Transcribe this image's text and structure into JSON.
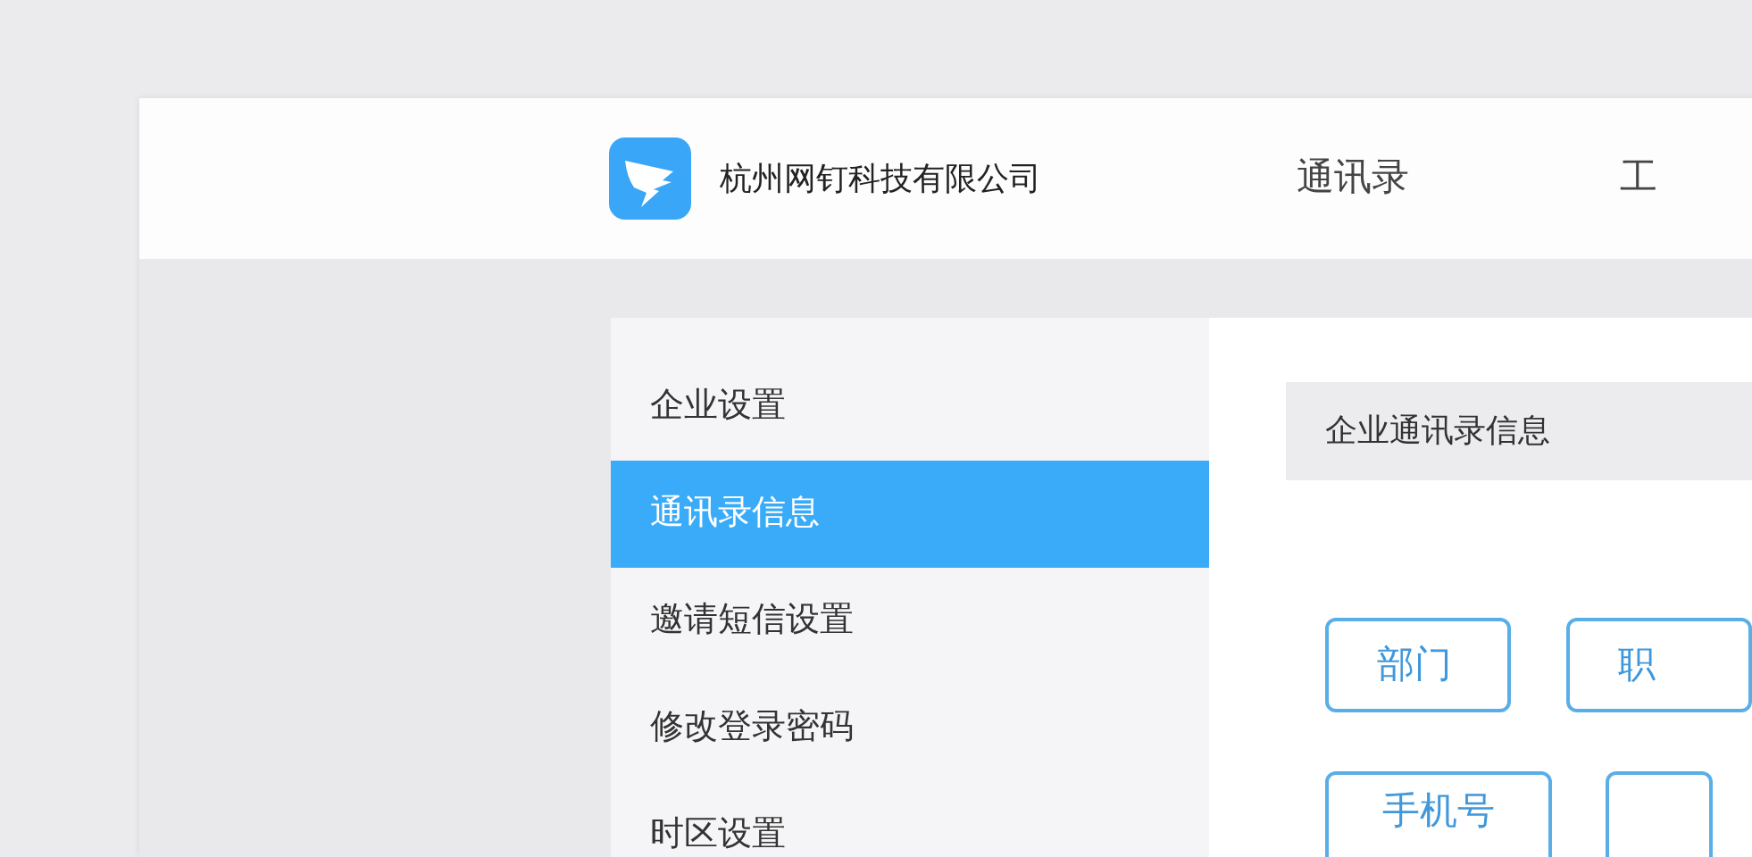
{
  "header": {
    "company": "杭州网钉科技有限公司",
    "nav": [
      {
        "label": "通讯录"
      },
      {
        "label": "工"
      }
    ]
  },
  "sidebar": {
    "items": [
      {
        "label": "企业设置",
        "selected": false
      },
      {
        "label": "通讯录信息",
        "selected": true
      },
      {
        "label": "邀请短信设置",
        "selected": false
      },
      {
        "label": "修改登录密码",
        "selected": false
      },
      {
        "label": "时区设置",
        "selected": false
      }
    ]
  },
  "content": {
    "section_title": "企业通讯录信息",
    "buttons": [
      {
        "label": "部门"
      },
      {
        "label": "职"
      },
      {
        "label": "手机号"
      }
    ]
  }
}
